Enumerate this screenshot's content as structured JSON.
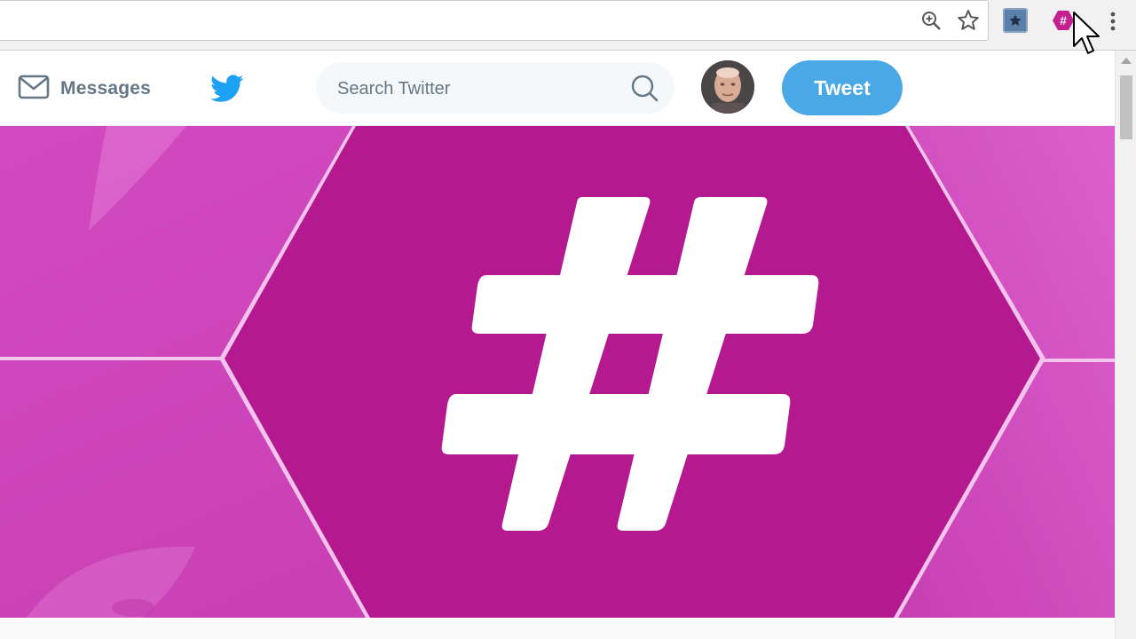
{
  "browser": {
    "icons": [
      "zoom-icon",
      "star-icon",
      "bookmark-extension-icon",
      "hashtag-extension-icon",
      "menu-icon"
    ]
  },
  "nav": {
    "messages_label": "Messages",
    "search_placeholder": "Search Twitter",
    "tweet_label": "Tweet"
  },
  "banner": {
    "symbol": "#"
  },
  "colors": {
    "twitter_blue": "#1da1f2",
    "tweet_button": "#4aa8e6",
    "banner_magenta": "#b5198f",
    "banner_light": "#d94bc4"
  }
}
